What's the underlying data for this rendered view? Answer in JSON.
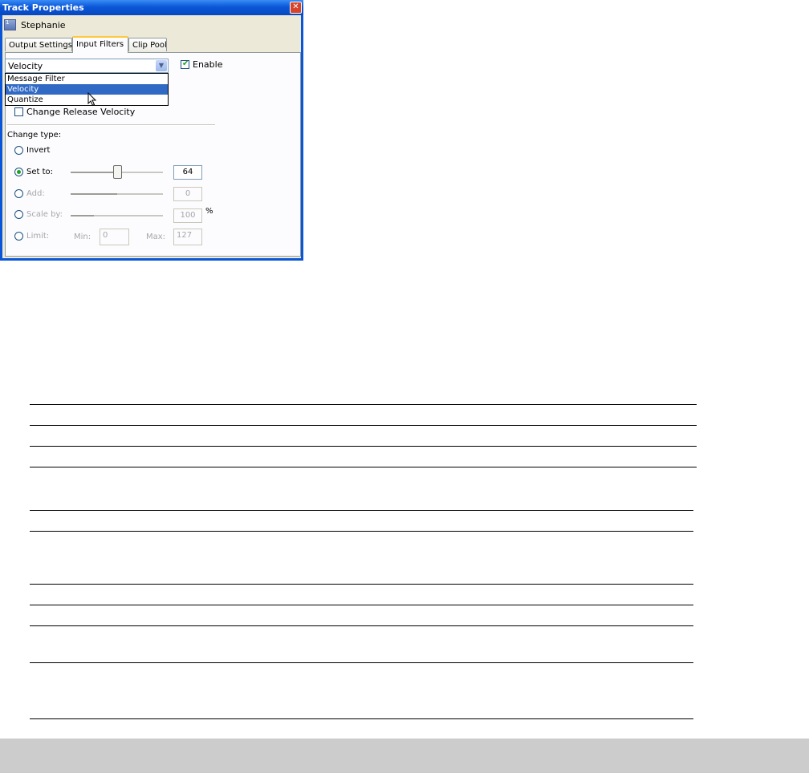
{
  "window": {
    "title": "Track Properties",
    "close_glyph": "✕"
  },
  "track": {
    "icon_number": "1",
    "name": "Stephanie"
  },
  "tabs": [
    {
      "label": "Output Settings",
      "active": false
    },
    {
      "label": "Input Filters",
      "active": true
    },
    {
      "label": "Clip Pool",
      "active": false
    }
  ],
  "filter_select": {
    "value": "Velocity",
    "options": [
      "Message Filter",
      "Velocity",
      "Quantize"
    ],
    "highlighted": "Velocity"
  },
  "enable": {
    "label": "Enable",
    "checked": true
  },
  "change_release": {
    "label": "Change Release Velocity",
    "checked": false
  },
  "change_type": {
    "heading": "Change type:",
    "invert": {
      "label": "Invert",
      "selected": false
    },
    "set_to": {
      "label": "Set to:",
      "selected": true,
      "value": "64",
      "slider_fraction": 0.5
    },
    "add": {
      "label": "Add:",
      "selected": false,
      "value": "0",
      "slider_fraction": 0.5
    },
    "scale_by": {
      "label": "Scale by:",
      "selected": false,
      "value": "100",
      "unit": "%",
      "slider_fraction": 0.25
    },
    "limit": {
      "label": "Limit:",
      "selected": false,
      "min_label": "Min:",
      "min_value": "0",
      "max_label": "Max:",
      "max_value": "127"
    }
  }
}
